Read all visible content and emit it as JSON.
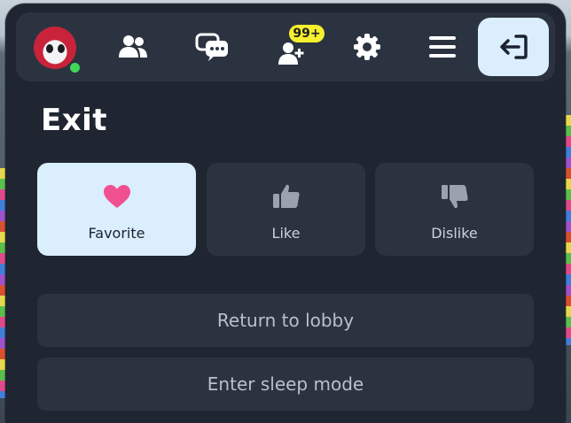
{
  "header": {
    "notifications_badge": "99+",
    "icons": [
      "avatar",
      "friends-icon",
      "chat-icon",
      "notifications-icon",
      "settings-icon",
      "menu-icon",
      "exit-icon"
    ]
  },
  "page": {
    "title": "Exit"
  },
  "vote": {
    "favorite_label": "Favorite",
    "like_label": "Like",
    "dislike_label": "Dislike",
    "selected": "Favorite"
  },
  "actions": {
    "return_label": "Return to lobby",
    "sleep_label": "Enter sleep mode"
  },
  "colors": {
    "panel": "#1f2531",
    "surface": "#2c3340",
    "selected": "#daeefd",
    "badge": "#f6f02f",
    "heart": "#f0508f",
    "online": "#3fd85a"
  }
}
